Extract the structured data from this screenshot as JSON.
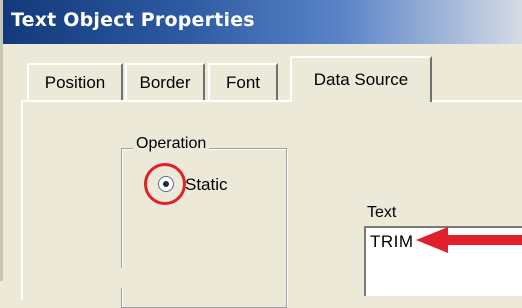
{
  "window": {
    "title": "Text Object Properties"
  },
  "tabs": [
    {
      "label": "Position"
    },
    {
      "label": "Border"
    },
    {
      "label": "Font"
    },
    {
      "label": "Data Source",
      "active": true
    }
  ],
  "operation_group": {
    "legend": "Operation",
    "radio": {
      "label": "Static",
      "selected": true
    }
  },
  "text_field": {
    "label": "Text",
    "value": "TRIM"
  },
  "annotations": {
    "highlight_color": "#e0202a",
    "arrow_color": "#e0202a"
  }
}
